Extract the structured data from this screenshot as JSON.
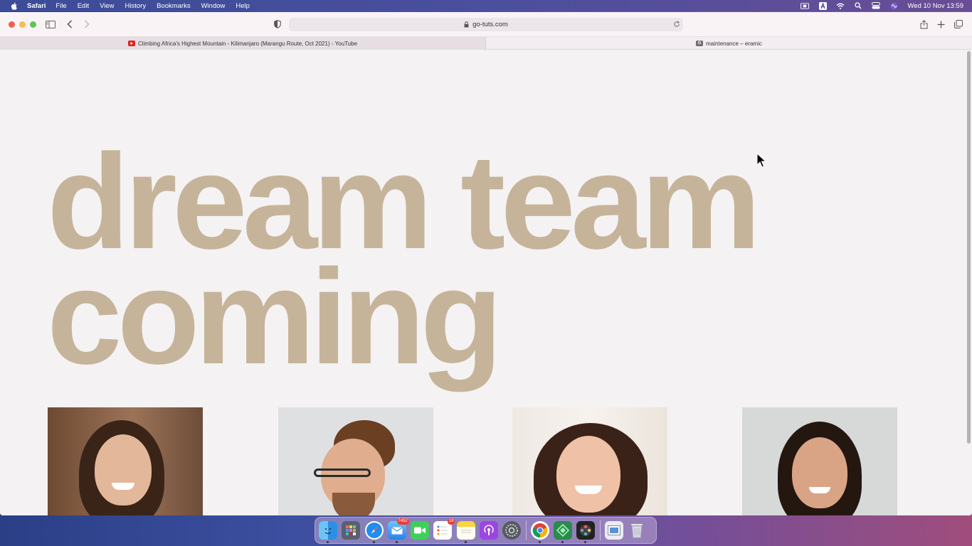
{
  "menubar": {
    "app_name": "Safari",
    "items": [
      "File",
      "Edit",
      "View",
      "History",
      "Bookmarks",
      "Window",
      "Help"
    ],
    "clock": "Wed 10 Nov  13:59",
    "status_icons": [
      "screen-record-icon",
      "keyboard-input-icon",
      "wifi-icon",
      "spotlight-search-icon",
      "control-center-icon",
      "siri-icon"
    ]
  },
  "browser": {
    "url": "go-tuts.com",
    "tabs": [
      {
        "title": "Climbing Africa's Highest Mountain - Kilimanjaro (Marangu Route, Oct 2021) - YouTube",
        "favicon": "youtube-icon",
        "active": true
      },
      {
        "title": "maintenance – eramic",
        "favicon": "g-favicon-icon",
        "active": false
      }
    ]
  },
  "page": {
    "headline_line1": "dream team",
    "headline_line2": "coming",
    "headline_color": "#c6b49a",
    "team_photos": [
      "team-member-photo-1",
      "team-member-photo-2",
      "team-member-photo-3",
      "team-member-photo-4"
    ]
  },
  "dock": {
    "apps": [
      "finder",
      "launchpad",
      "safari",
      "mail",
      "facetime",
      "reminders",
      "notes",
      "podcasts",
      "system-preferences",
      "chrome",
      "sketch-app",
      "final-cut",
      "preview",
      "trash"
    ],
    "mail_badge": "7452",
    "reminders_badge": "18"
  }
}
